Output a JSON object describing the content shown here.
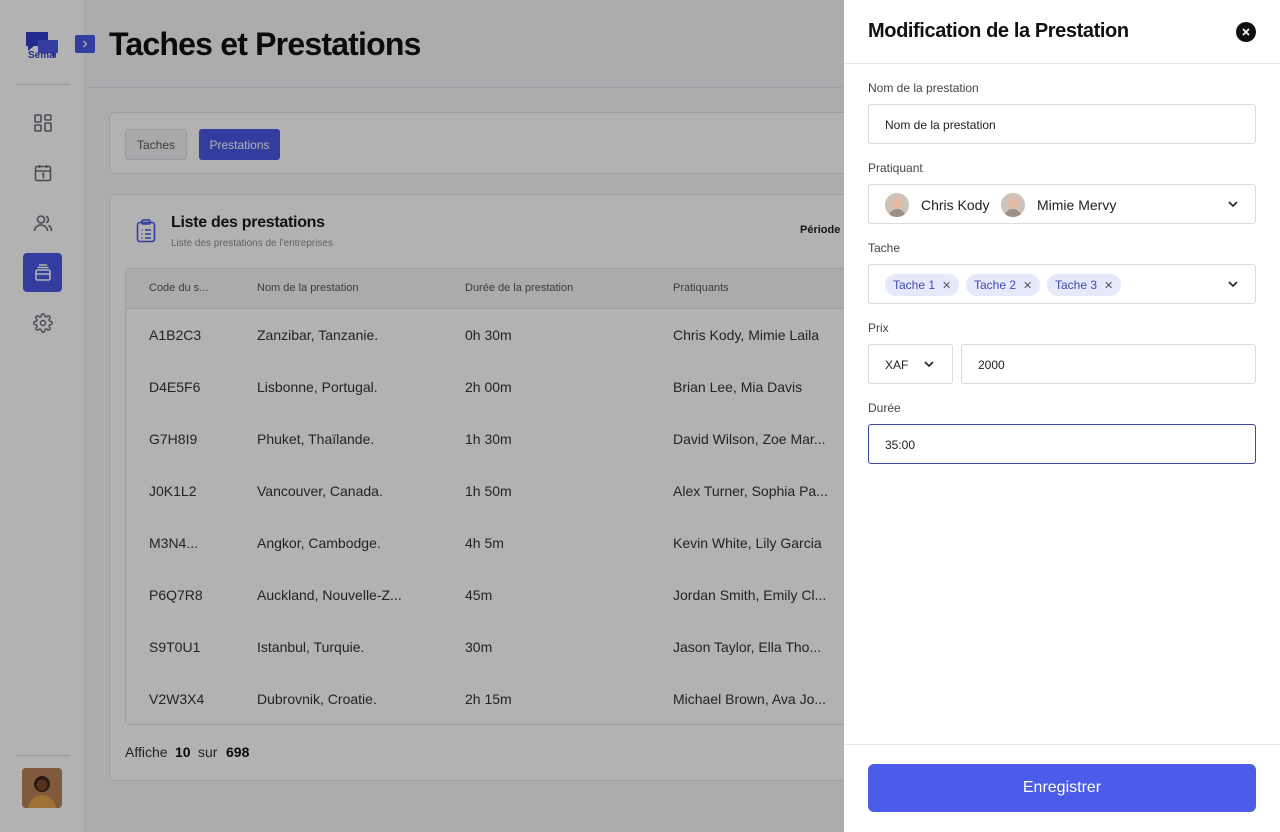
{
  "app": {
    "logo_text": "Sema",
    "page_title": "Taches et Prestations"
  },
  "tabs": [
    {
      "label": "Taches",
      "active": false
    },
    {
      "label": "Prestations",
      "active": true
    }
  ],
  "list": {
    "title": "Liste des prestations",
    "subtitle": "Liste des prestations de l'entreprises",
    "period_label": "Période :"
  },
  "table": {
    "headers": [
      "Code du s...",
      "Nom de la prestation",
      "Durée de la prestation",
      "Pratiquants"
    ],
    "rows": [
      [
        "A1B2C3",
        "Zanzibar, Tanzanie.",
        "0h 30m",
        "Chris Kody, Mimie Laila"
      ],
      [
        "D4E5F6",
        "Lisbonne, Portugal.",
        "2h 00m",
        "Brian Lee, Mia Davis"
      ],
      [
        "G7H8I9",
        "Phuket, Thaïlande.",
        "1h 30m",
        "David Wilson, Zoe Mar..."
      ],
      [
        "J0K1L2",
        "Vancouver, Canada.",
        "1h 50m",
        "Alex Turner, Sophia Pa..."
      ],
      [
        "M3N4...",
        "Angkor, Cambodge.",
        "4h 5m",
        "Kevin White, Lily Garcia"
      ],
      [
        "P6Q7R8",
        "Auckland, Nouvelle-Z...",
        "45m",
        "Jordan Smith, Emily Cl..."
      ],
      [
        "S9T0U1",
        "Istanbul, Turquie.",
        "30m",
        "Jason Taylor, Ella Tho..."
      ],
      [
        "V2W3X4",
        "Dubrovnik, Croatie.",
        "2h 15m",
        "Michael Brown, Ava Jo..."
      ]
    ]
  },
  "pager": {
    "prefix": "Affiche",
    "count": "10",
    "separator": "sur",
    "total": "698"
  },
  "drawer": {
    "title": "Modification de la Prestation",
    "name_label": "Nom de la prestation",
    "name_value": "Nom de la prestation",
    "practitioner_label": "Pratiquant",
    "practitioners": [
      "Chris Kody",
      "Mimie Mervy"
    ],
    "task_label": "Tache",
    "tasks": [
      "Tache 1",
      "Tache 2",
      "Tache 3"
    ],
    "price_label": "Prix",
    "currency": "XAF",
    "price_value": "2000",
    "duration_label": "Durée",
    "duration_value": "35:00",
    "save_label": "Enregistrer"
  },
  "colors": {
    "accent": "#4a58e6",
    "chip_bg": "#e6e8fb",
    "chip_text": "#3f4ab8"
  }
}
